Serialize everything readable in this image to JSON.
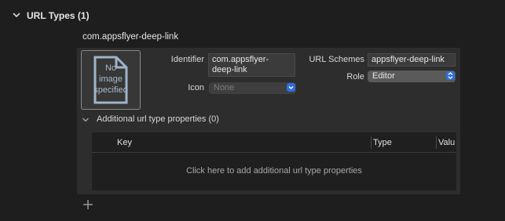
{
  "section": {
    "title": "URL Types (1)"
  },
  "url_type": {
    "name": "com.appsflyer-deep-link",
    "image_placeholder": {
      "line1": "No",
      "line2": "image",
      "line3": "specified"
    },
    "identifier": {
      "label": "Identifier",
      "value_line1": "com.appsflyer-",
      "value_line2": "deep-link"
    },
    "icon": {
      "label": "Icon",
      "value": "None"
    },
    "url_schemes": {
      "label": "URL Schemes",
      "value": "appsflyer-deep-link"
    },
    "role": {
      "label": "Role",
      "value": "Editor"
    }
  },
  "additional": {
    "title": "Additional url type properties (0)",
    "columns": {
      "key": "Key",
      "type": "Type",
      "value": "Valu"
    },
    "empty_message": "Click here to add additional url type properties"
  },
  "colors": {
    "accent": "#2f6fde",
    "panel": "#2d2d2d",
    "background": "#1e1e1e"
  }
}
